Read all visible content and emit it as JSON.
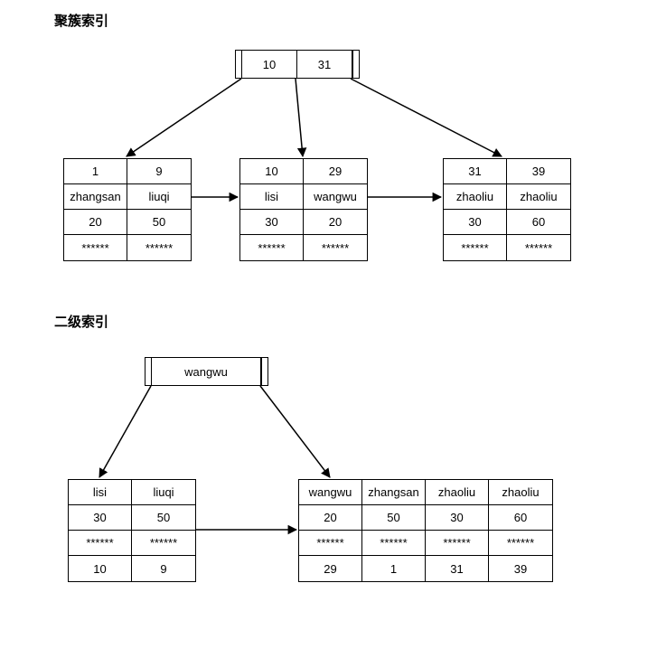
{
  "section1": {
    "title": "聚簇索引"
  },
  "section2": {
    "title": "二级索引"
  },
  "clustered": {
    "root": {
      "k1": "10",
      "k2": "31"
    },
    "leaf1": {
      "r1": [
        "1",
        "9"
      ],
      "r2": [
        "zhangsan",
        "liuqi"
      ],
      "r3": [
        "20",
        "50"
      ],
      "r4": [
        "******",
        "******"
      ]
    },
    "leaf2": {
      "r1": [
        "10",
        "29"
      ],
      "r2": [
        "lisi",
        "wangwu"
      ],
      "r3": [
        "30",
        "20"
      ],
      "r4": [
        "******",
        "******"
      ]
    },
    "leaf3": {
      "r1": [
        "31",
        "39"
      ],
      "r2": [
        "zhaoliu",
        "zhaoliu"
      ],
      "r3": [
        "30",
        "60"
      ],
      "r4": [
        "******",
        "******"
      ]
    }
  },
  "secondary": {
    "root": {
      "k1": "wangwu"
    },
    "leaf1": {
      "r1": [
        "lisi",
        "liuqi"
      ],
      "r2": [
        "30",
        "50"
      ],
      "r3": [
        "******",
        "******"
      ],
      "r4": [
        "10",
        "9"
      ]
    },
    "leaf2": {
      "r1": [
        "wangwu",
        "zhangsan",
        "zhaoliu",
        "zhaoliu"
      ],
      "r2": [
        "20",
        "50",
        "30",
        "60"
      ],
      "r3": [
        "******",
        "******",
        "******",
        "******"
      ],
      "r4": [
        "29",
        "1",
        "31",
        "39"
      ]
    }
  }
}
